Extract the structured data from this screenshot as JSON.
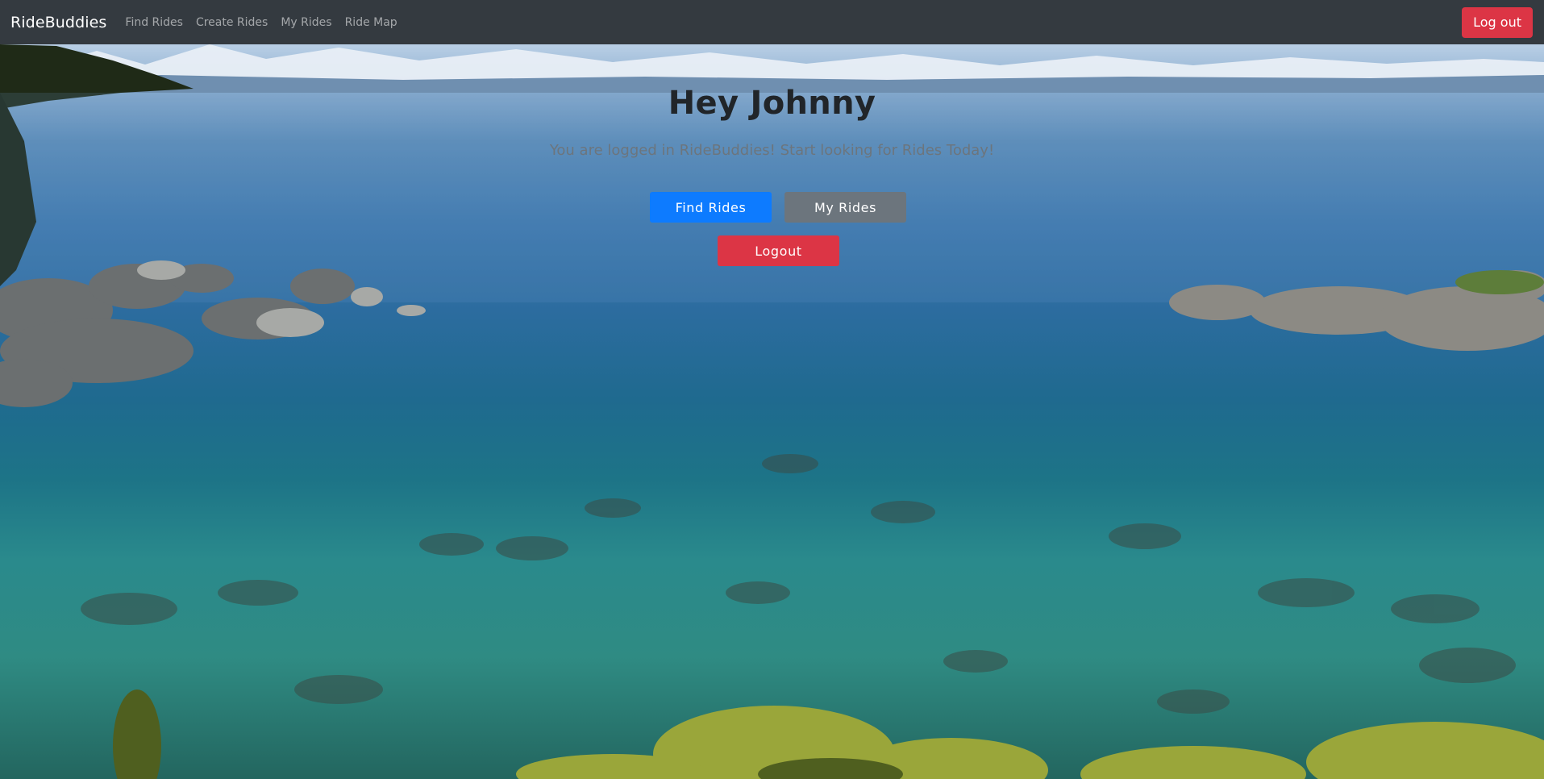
{
  "navbar": {
    "brand": "RideBuddies",
    "links": [
      "Find Rides",
      "Create Rides",
      "My Rides",
      "Ride Map"
    ],
    "logout_label": "Log out"
  },
  "hero": {
    "title": "Hey Johnny",
    "subtitle": "You are logged in RideBuddies! Start looking for Rides Today!",
    "find_rides_label": "Find Rides",
    "my_rides_label": "My Rides",
    "logout_label": "Logout"
  },
  "colors": {
    "navbar_bg": "#343a40",
    "primary": "#0d7bff",
    "secondary": "#6c757d",
    "danger": "#dc3545"
  }
}
